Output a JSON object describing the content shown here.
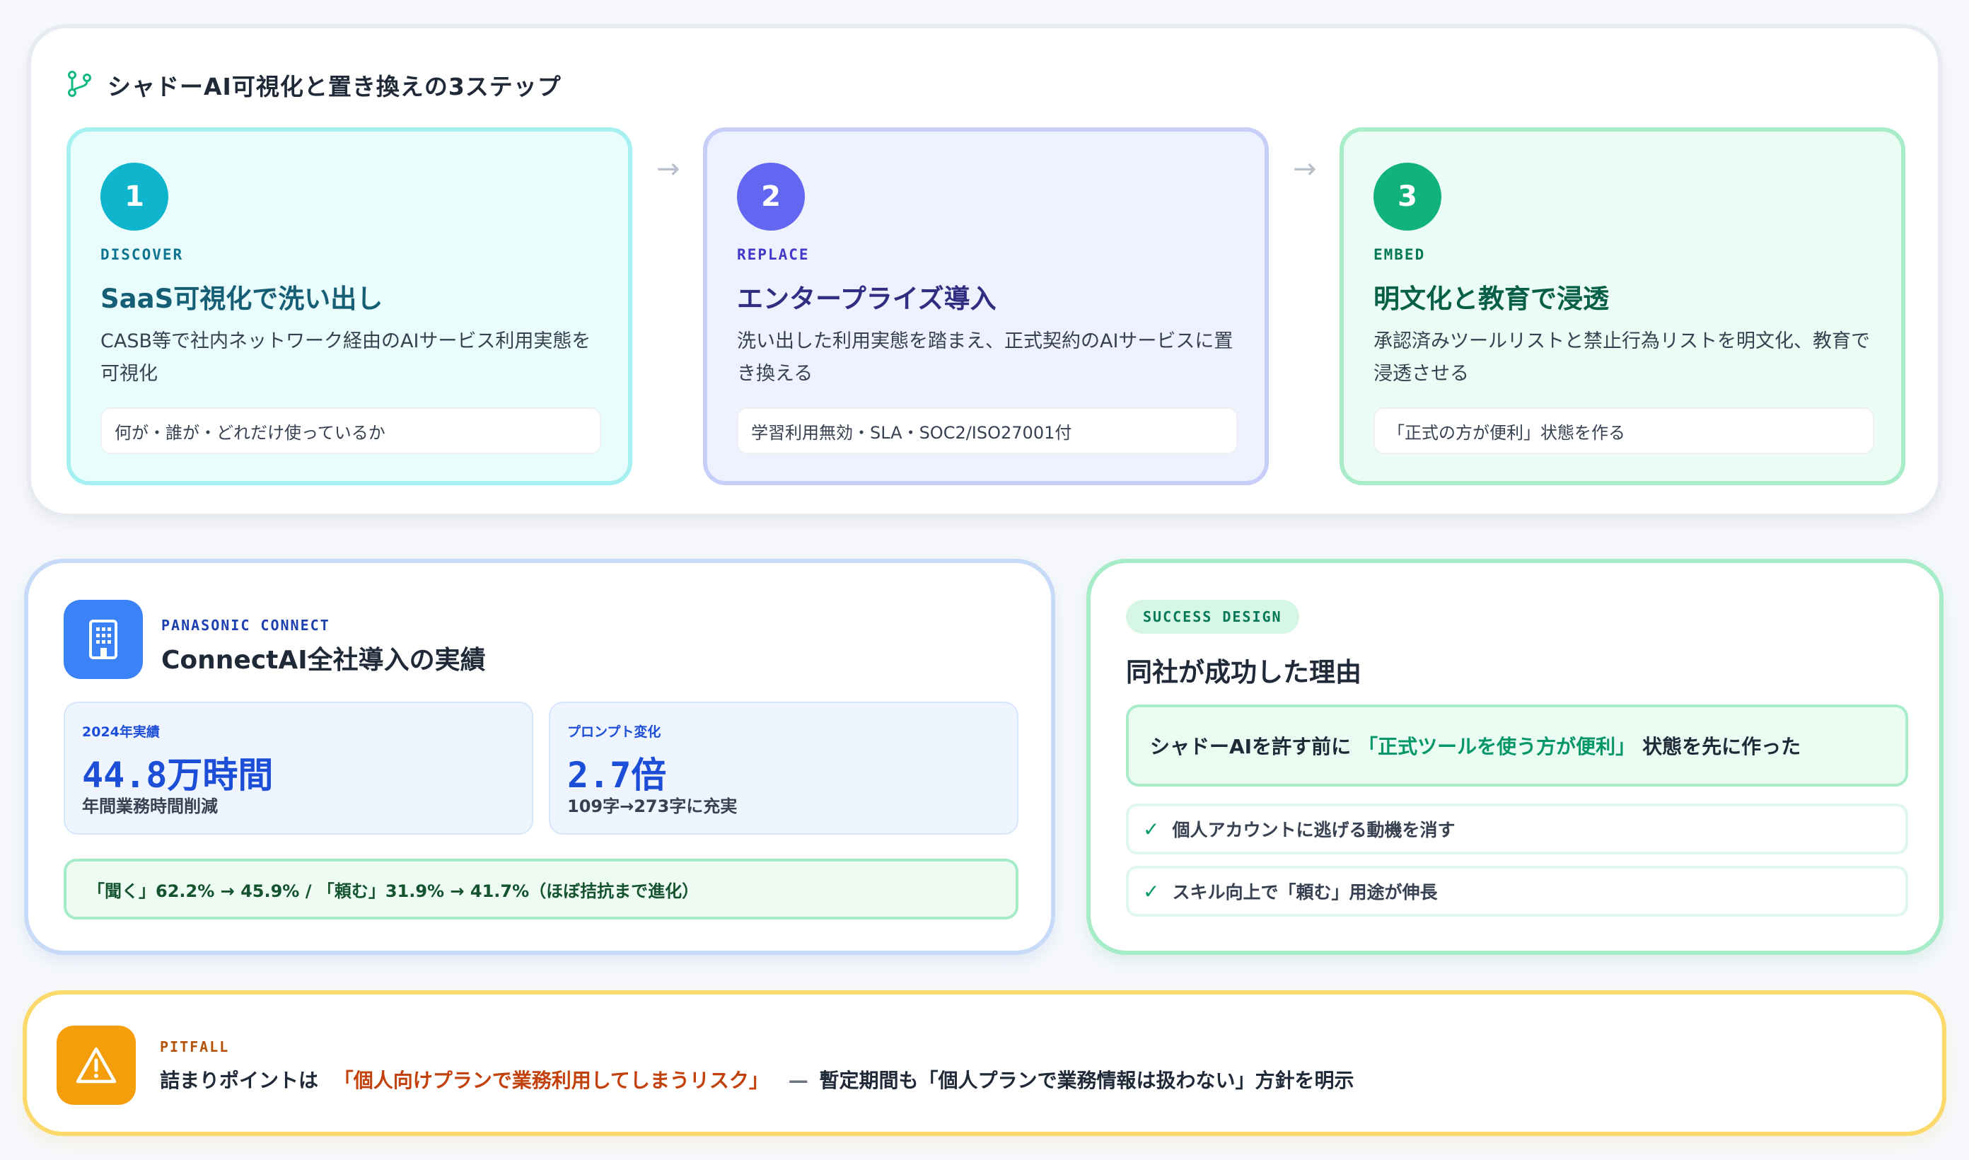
{
  "top": {
    "title": "シャドーAI可視化と置き換えの3ステップ",
    "title_icon": "git-branch-icon",
    "arrow_glyph": "→",
    "steps": [
      {
        "num": "1",
        "tag": "DISCOVER",
        "title": "SaaS可視化で洗い出し",
        "desc": "CASB等で社内ネットワーク経由のAIサービス利用実態を可視化",
        "note": "何が・誰が・どれだけ使っているか",
        "color": "#0fb5cc"
      },
      {
        "num": "2",
        "tag": "REPLACE",
        "title": "エンタープライズ導入",
        "desc": "洗い出した利用実態を踏まえ、正式契約のAIサービスに置き換える",
        "note": "学習利用無効・SLA・SOC2/ISO27001付",
        "color": "#6366f1"
      },
      {
        "num": "3",
        "tag": "EMBED",
        "title": "明文化と教育で浸透",
        "desc": "承認済みツールリストと禁止行為リストを明文化、教育で浸透させる",
        "note": "「正式の方が便利」状態を作る",
        "color": "#12b37a"
      }
    ]
  },
  "case": {
    "icon": "building-icon",
    "kicker": "PANASONIC CONNECT",
    "title": "ConnectAI全社導入の実績",
    "metrics": [
      {
        "label": "2024年実績",
        "value": "44.8万時間",
        "sub": "年間業務時間削減"
      },
      {
        "label": "プロンプト変化",
        "value": "2.7倍",
        "sub": "109字→273字に充実"
      }
    ],
    "footer": "「聞く」62.2% → 45.9% / 「頼む」31.9% → 41.7%（ほぼ拮抗まで進化）"
  },
  "success": {
    "pill": "SUCCESS DESIGN",
    "title": "同社が成功した理由",
    "main_before": "シャドーAIを許す前に",
    "main_highlight": "「正式ツールを使う方が便利」",
    "main_after": "状態を先に作った",
    "check_glyph": "✓",
    "checks": [
      "個人アカウントに逃げる動機を消す",
      "スキル向上で「頼む」用途が伸長"
    ]
  },
  "pitfall": {
    "icon": "warning-icon",
    "kicker": "PITFALL",
    "text_before": "詰まりポイントは",
    "text_highlight": "「個人向けプランで業務利用してしまうリスク」",
    "dash": "—",
    "text_after": "暫定期間も「個人プランで業務情報は扱わない」方針を明示"
  }
}
